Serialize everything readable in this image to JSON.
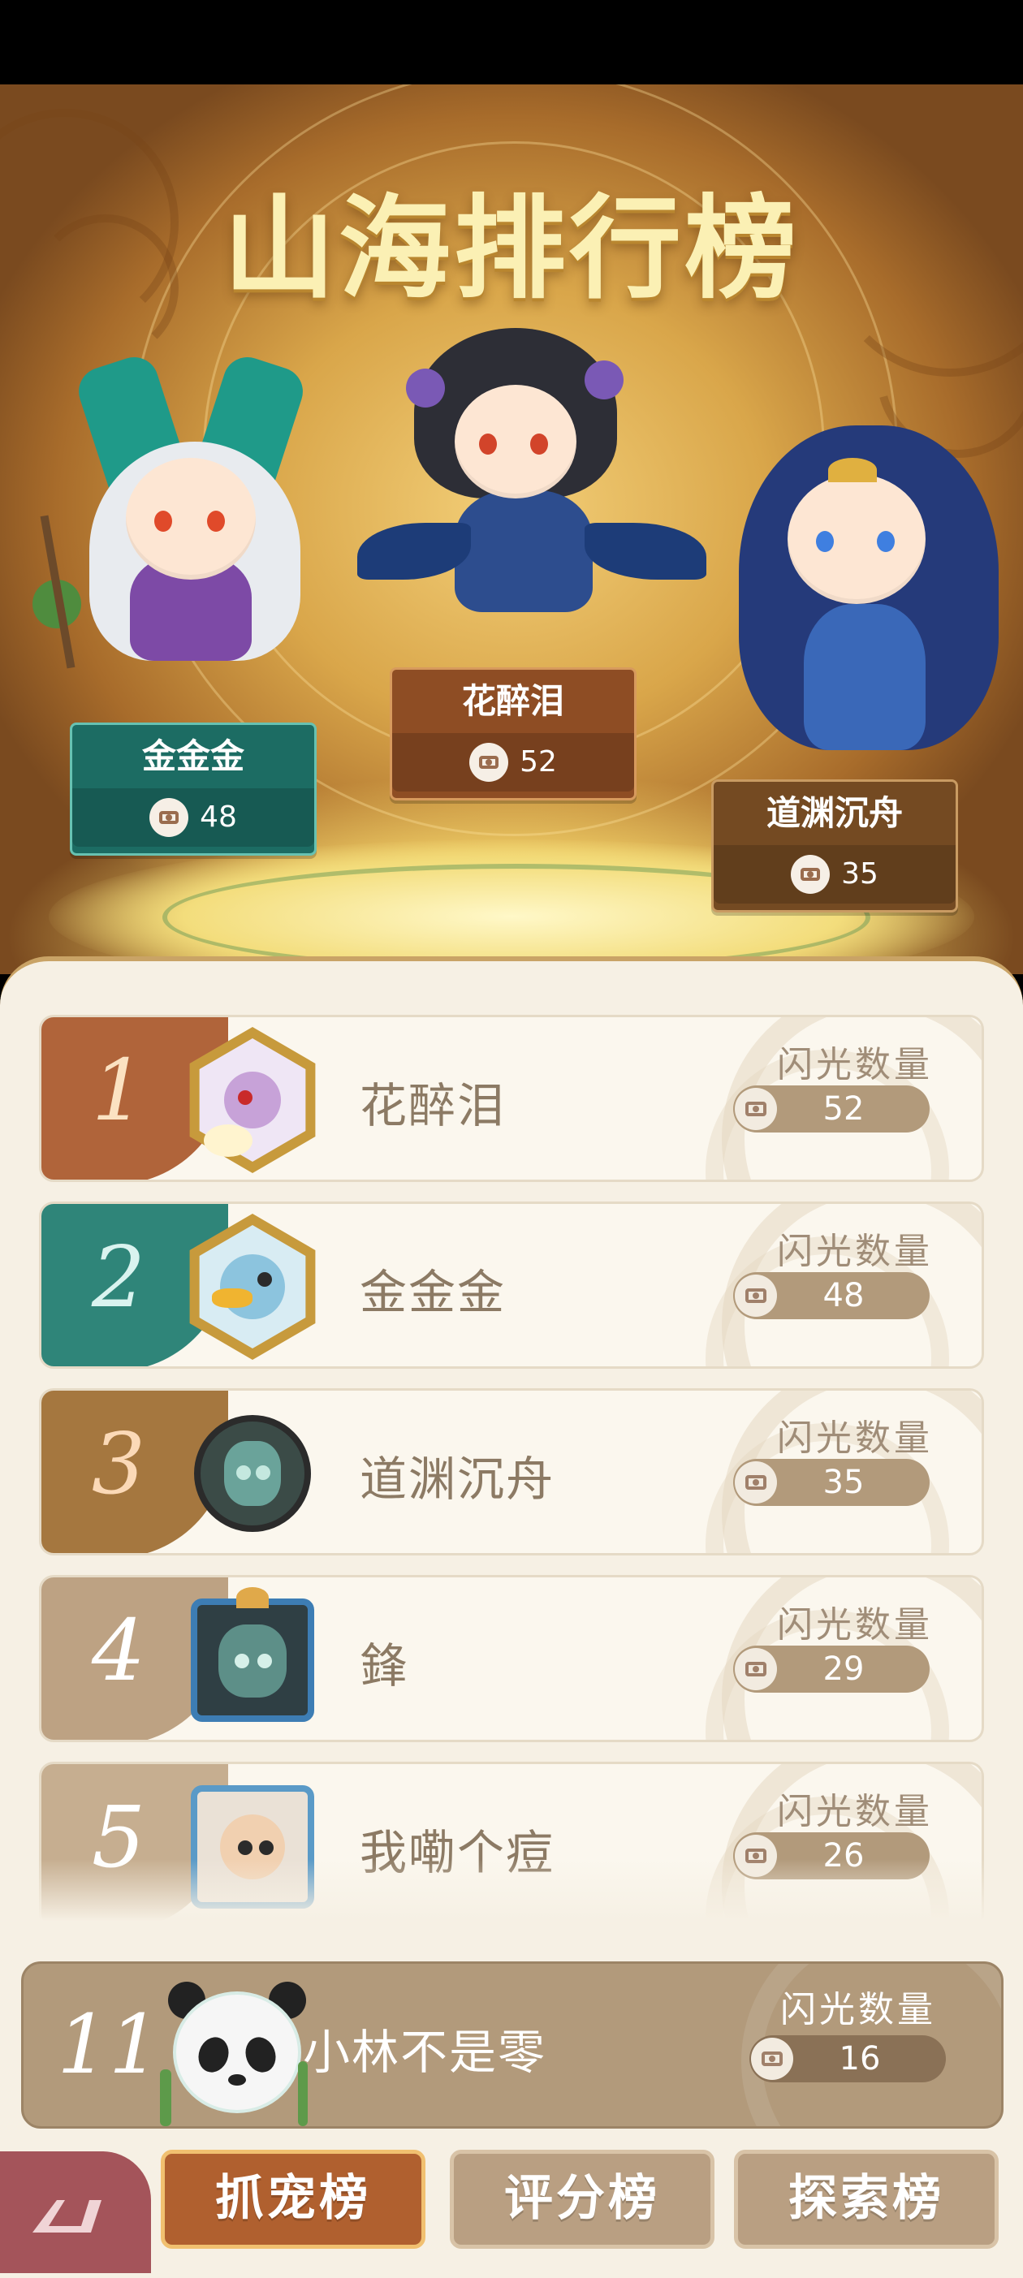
{
  "hero": {
    "title": "山海排行榜",
    "podium": [
      {
        "name": "金金金",
        "count": "48",
        "color": "#1c6c63"
      },
      {
        "name": "花醉泪",
        "count": "52",
        "color": "#8e4d24"
      },
      {
        "name": "道渊沉舟",
        "count": "35",
        "color": "#744a22"
      }
    ]
  },
  "ranking": {
    "flash_label": "闪光数量",
    "rows": [
      {
        "rank": "1",
        "name": "花醉泪",
        "count": "52",
        "color": "#b0643a"
      },
      {
        "rank": "2",
        "name": "金金金",
        "count": "48",
        "color": "#2f8579"
      },
      {
        "rank": "3",
        "name": "道渊沉舟",
        "count": "35",
        "color": "#a5773f"
      },
      {
        "rank": "4",
        "name": "鋒",
        "count": "29",
        "color": "#bda283"
      },
      {
        "rank": "5",
        "name": "我嘞个痘",
        "count": "26",
        "color": "#c6ae90"
      }
    ]
  },
  "my_rank": {
    "rank": "11",
    "name": "小林不是零",
    "count": "16",
    "flash_label": "闪光数量"
  },
  "tabs": [
    {
      "label": "抓宠榜",
      "active": true
    },
    {
      "label": "评分榜",
      "active": false
    },
    {
      "label": "探索榜",
      "active": false
    }
  ]
}
